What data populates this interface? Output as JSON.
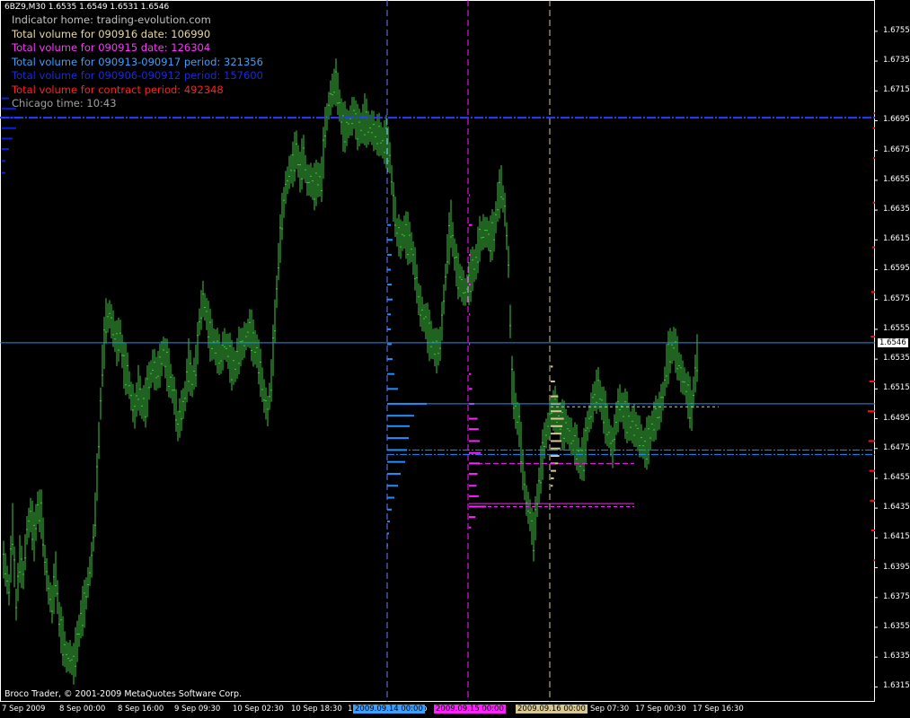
{
  "window": {
    "title": "6BZ9,M30  1.6535 1.6549 1.6531 1.6546",
    "copyright": "Broco Trader, © 2001-2009 MetaQuotes Software Corp."
  },
  "info_lines": [
    {
      "label": "Indicator home: trading-evolution.com",
      "value": "",
      "color": "#c0c0c0"
    },
    {
      "label": "Total volume for 090916 date: ",
      "value": "106990",
      "color": "#e8d8a8"
    },
    {
      "label": "Total volume for 090915 date: ",
      "value": "126304",
      "color": "#ff33ff"
    },
    {
      "label": "Total volume for 090913-090917 period: ",
      "value": "321356",
      "color": "#3aa0ff"
    },
    {
      "label": "Total volume for 090906-090912 period: ",
      "value": "157600",
      "color": "#1a2ad8"
    },
    {
      "label": "Total volume for contract period: ",
      "value": "492348",
      "color": "#ff2020"
    },
    {
      "label": "Chicago time: ",
      "value": "10:43",
      "color": "#a0a0a0"
    }
  ],
  "current_price_label": "1.6546",
  "colors": {
    "candles": "#3fc43f",
    "profile_week": "#1e90ff",
    "profile_prev_week": "#0a1ee0",
    "profile_0915": "#ff20ff",
    "profile_0916": "#d8c890",
    "profile_contract": "#ff1010",
    "session_0914": "#6b7cff",
    "session_0915": "#ff20ff",
    "session_0916": "#d8c890"
  },
  "chart_data": {
    "type": "candlestick",
    "symbol": "6BZ9",
    "timeframe": "M30",
    "y_ticks": [
      "1.6755",
      "1.6735",
      "1.6715",
      "1.6695",
      "1.6675",
      "1.6655",
      "1.6635",
      "1.6615",
      "1.6595",
      "1.6575",
      "1.6555",
      "1.6535",
      "1.6515",
      "1.6495",
      "1.6475",
      "1.6455",
      "1.6435",
      "1.6415",
      "1.6395",
      "1.6375",
      "1.6355",
      "1.6335",
      "1.6315"
    ],
    "ylim": [
      1.6311,
      1.6776
    ],
    "x_ticks": [
      "7 Sep 2009",
      "8 Sep 00:00",
      "8 Sep 16:00",
      "9 Sep 09:30",
      "10 Sep 02:30",
      "10 Sep 18:30",
      "1",
      "p",
      "Sep 07:30",
      "17 Sep 00:30",
      "17 Sep 16:30"
    ],
    "session_markers": [
      {
        "label": "2009.09.14 00:00",
        "color": "#3aa0ff"
      },
      {
        "label": "2009.09.15 00:00",
        "color": "#ff20ff"
      },
      {
        "label": "2009.09.16 00:00",
        "color": "#d8c890"
      }
    ],
    "current_price": 1.6546,
    "levels": [
      {
        "name": "prev-week-poc",
        "price": 1.6697
      },
      {
        "name": "week-poc",
        "price": 1.6505
      },
      {
        "name": "value-area-high",
        "price": 1.6474
      },
      {
        "name": "value-area-low",
        "price": 1.6471
      },
      {
        "name": "0915-poc-high",
        "price": 1.6438
      },
      {
        "name": "0915-poc-low",
        "price": 1.6436
      },
      {
        "name": "0915-va",
        "price": 1.6465
      }
    ],
    "price_path": [
      [
        0,
        1.64
      ],
      [
        6,
        1.638
      ],
      [
        10,
        1.642
      ],
      [
        14,
        1.637
      ],
      [
        18,
        1.64
      ],
      [
        22,
        1.639
      ],
      [
        26,
        1.642
      ],
      [
        30,
        1.643
      ],
      [
        34,
        1.6415
      ],
      [
        38,
        1.6435
      ],
      [
        42,
        1.643
      ],
      [
        46,
        1.64
      ],
      [
        50,
        1.638
      ],
      [
        54,
        1.637
      ],
      [
        58,
        1.639
      ],
      [
        62,
        1.636
      ],
      [
        66,
        1.6345
      ],
      [
        70,
        1.6335
      ],
      [
        74,
        1.6335
      ],
      [
        78,
        1.633
      ],
      [
        82,
        1.6345
      ],
      [
        86,
        1.636
      ],
      [
        90,
        1.637
      ],
      [
        94,
        1.6385
      ],
      [
        98,
        1.64
      ],
      [
        102,
        1.643
      ],
      [
        106,
        1.648
      ],
      [
        110,
        1.653
      ],
      [
        114,
        1.656
      ],
      [
        118,
        1.6565
      ],
      [
        122,
        1.6555
      ],
      [
        126,
        1.6545
      ],
      [
        130,
        1.655
      ],
      [
        134,
        1.653
      ],
      [
        138,
        1.6525
      ],
      [
        142,
        1.651
      ],
      [
        146,
        1.65
      ],
      [
        150,
        1.6515
      ],
      [
        154,
        1.6505
      ],
      [
        158,
        1.6505
      ],
      [
        162,
        1.652
      ],
      [
        166,
        1.653
      ],
      [
        170,
        1.6525
      ],
      [
        174,
        1.653
      ],
      [
        178,
        1.654
      ],
      [
        182,
        1.653
      ],
      [
        186,
        1.652
      ],
      [
        190,
        1.651
      ],
      [
        194,
        1.649
      ],
      [
        198,
        1.65
      ],
      [
        202,
        1.651
      ],
      [
        206,
        1.653
      ],
      [
        210,
        1.652
      ],
      [
        214,
        1.653
      ],
      [
        218,
        1.656
      ],
      [
        222,
        1.6575
      ],
      [
        226,
        1.6565
      ],
      [
        230,
        1.655
      ],
      [
        234,
        1.6545
      ],
      [
        238,
        1.654
      ],
      [
        242,
        1.6535
      ],
      [
        246,
        1.6545
      ],
      [
        250,
        1.654
      ],
      [
        254,
        1.653
      ],
      [
        258,
        1.653
      ],
      [
        262,
        1.654
      ],
      [
        266,
        1.6545
      ],
      [
        270,
        1.655
      ],
      [
        274,
        1.6555
      ],
      [
        278,
        1.6545
      ],
      [
        282,
        1.654
      ],
      [
        286,
        1.6525
      ],
      [
        290,
        1.651
      ],
      [
        294,
        1.65
      ],
      [
        298,
        1.652
      ],
      [
        302,
        1.656
      ],
      [
        306,
        1.66
      ],
      [
        310,
        1.663
      ],
      [
        314,
        1.665
      ],
      [
        318,
        1.666
      ],
      [
        322,
        1.6665
      ],
      [
        326,
        1.6675
      ],
      [
        330,
        1.666
      ],
      [
        334,
        1.667
      ],
      [
        338,
        1.6655
      ],
      [
        342,
        1.6655
      ],
      [
        346,
        1.665
      ],
      [
        350,
        1.6655
      ],
      [
        354,
        1.6655
      ],
      [
        358,
        1.669
      ],
      [
        362,
        1.6705
      ],
      [
        366,
        1.6715
      ],
      [
        370,
        1.672
      ],
      [
        374,
        1.6705
      ],
      [
        378,
        1.669
      ],
      [
        382,
        1.669
      ],
      [
        386,
        1.6695
      ],
      [
        390,
        1.67
      ],
      [
        394,
        1.669
      ],
      [
        398,
        1.669
      ],
      [
        402,
        1.6695
      ],
      [
        406,
        1.669
      ],
      [
        410,
        1.669
      ],
      [
        414,
        1.6685
      ],
      [
        418,
        1.6685
      ],
      [
        422,
        1.668
      ],
      [
        426,
        1.668
      ],
      [
        430,
        1.667
      ],
      [
        434,
        1.664
      ],
      [
        438,
        1.662
      ],
      [
        442,
        1.6615
      ],
      [
        446,
        1.662
      ],
      [
        450,
        1.6615
      ],
      [
        454,
        1.661
      ],
      [
        458,
        1.6595
      ],
      [
        462,
        1.6575
      ],
      [
        466,
        1.6565
      ],
      [
        470,
        1.656
      ],
      [
        474,
        1.655
      ],
      [
        478,
        1.6545
      ],
      [
        482,
        1.654
      ],
      [
        486,
        1.6545
      ],
      [
        490,
        1.6575
      ],
      [
        494,
        1.6605
      ],
      [
        498,
        1.6625
      ],
      [
        502,
        1.6605
      ],
      [
        506,
        1.659
      ],
      [
        510,
        1.6585
      ],
      [
        514,
        1.658
      ],
      [
        518,
        1.6585
      ],
      [
        522,
        1.6595
      ],
      [
        526,
        1.66
      ],
      [
        530,
        1.6615
      ],
      [
        534,
        1.662
      ],
      [
        538,
        1.662
      ],
      [
        542,
        1.6615
      ],
      [
        546,
        1.662
      ],
      [
        550,
        1.664
      ],
      [
        554,
        1.665
      ],
      [
        558,
        1.6635
      ],
      [
        562,
        1.66
      ],
      [
        566,
        1.652
      ],
      [
        570,
        1.65
      ],
      [
        574,
        1.649
      ],
      [
        578,
        1.646
      ],
      [
        582,
        1.644
      ],
      [
        586,
        1.643
      ],
      [
        590,
        1.6415
      ],
      [
        594,
        1.644
      ],
      [
        598,
        1.646
      ],
      [
        602,
        1.648
      ],
      [
        606,
        1.649
      ],
      [
        610,
        1.65
      ],
      [
        614,
        1.65
      ],
      [
        618,
        1.6495
      ],
      [
        622,
        1.649
      ],
      [
        626,
        1.649
      ],
      [
        630,
        1.6485
      ],
      [
        634,
        1.648
      ],
      [
        638,
        1.6475
      ],
      [
        642,
        1.6465
      ],
      [
        646,
        1.647
      ],
      [
        650,
        1.649
      ],
      [
        654,
        1.65
      ],
      [
        658,
        1.651
      ],
      [
        662,
        1.6515
      ],
      [
        666,
        1.6505
      ],
      [
        670,
        1.6495
      ],
      [
        674,
        1.6485
      ],
      [
        678,
        1.6475
      ],
      [
        682,
        1.6495
      ],
      [
        686,
        1.6505
      ],
      [
        690,
        1.65
      ],
      [
        694,
        1.6495
      ],
      [
        698,
        1.649
      ],
      [
        702,
        1.649
      ],
      [
        706,
        1.6485
      ],
      [
        710,
        1.648
      ],
      [
        714,
        1.6475
      ],
      [
        718,
        1.648
      ],
      [
        722,
        1.649
      ],
      [
        726,
        1.6495
      ],
      [
        730,
        1.65
      ],
      [
        734,
        1.651
      ],
      [
        738,
        1.653
      ],
      [
        742,
        1.654
      ],
      [
        746,
        1.6545
      ],
      [
        750,
        1.6535
      ],
      [
        754,
        1.6525
      ],
      [
        758,
        1.652
      ],
      [
        762,
        1.651
      ],
      [
        766,
        1.65
      ],
      [
        770,
        1.6525
      ],
      [
        774,
        1.6545
      ]
    ],
    "profile_week": [
      [
        1.6625,
        0.04
      ],
      [
        1.6615,
        0.06
      ],
      [
        1.6605,
        0.05
      ],
      [
        1.6595,
        0.04
      ],
      [
        1.6585,
        0.05
      ],
      [
        1.6575,
        0.06
      ],
      [
        1.6565,
        0.04
      ],
      [
        1.6555,
        0.04
      ],
      [
        1.6545,
        0.05
      ],
      [
        1.6535,
        0.06
      ],
      [
        1.6525,
        0.08
      ],
      [
        1.6515,
        0.12
      ],
      [
        1.6505,
        0.44
      ],
      [
        1.6497,
        0.3
      ],
      [
        1.649,
        0.25
      ],
      [
        1.6482,
        0.24
      ],
      [
        1.6474,
        0.22
      ],
      [
        1.6466,
        0.2
      ],
      [
        1.6458,
        0.15
      ],
      [
        1.645,
        0.12
      ],
      [
        1.6442,
        0.08
      ],
      [
        1.6434,
        0.05
      ],
      [
        1.6426,
        0.03
      ],
      [
        1.6418,
        0.02
      ],
      [
        1.641,
        0.01
      ]
    ],
    "profile_0915": [
      [
        1.6645,
        0.01
      ],
      [
        1.6625,
        0.03
      ],
      [
        1.6605,
        0.02
      ],
      [
        1.6585,
        0.02
      ],
      [
        1.6565,
        0.01
      ],
      [
        1.6545,
        0.01
      ],
      [
        1.6525,
        0.02
      ],
      [
        1.6515,
        0.03
      ],
      [
        1.6505,
        0.05
      ],
      [
        1.6495,
        0.08
      ],
      [
        1.6488,
        0.09
      ],
      [
        1.648,
        0.1
      ],
      [
        1.6472,
        0.11
      ],
      [
        1.6465,
        0.1
      ],
      [
        1.6458,
        0.08
      ],
      [
        1.645,
        0.07
      ],
      [
        1.6443,
        0.09
      ],
      [
        1.6436,
        0.16
      ],
      [
        1.6429,
        0.06
      ],
      [
        1.6422,
        0.02
      ]
    ],
    "profile_0916": [
      [
        1.653,
        0.02
      ],
      [
        1.652,
        0.04
      ],
      [
        1.651,
        0.07
      ],
      [
        1.6505,
        0.09
      ],
      [
        1.65,
        0.1
      ],
      [
        1.6495,
        0.12
      ],
      [
        1.649,
        0.11
      ],
      [
        1.6485,
        0.1
      ],
      [
        1.648,
        0.1
      ],
      [
        1.6475,
        0.09
      ],
      [
        1.647,
        0.08
      ],
      [
        1.6465,
        0.07
      ],
      [
        1.646,
        0.05
      ],
      [
        1.6455,
        0.03
      ],
      [
        1.645,
        0.02
      ]
    ],
    "profile_prev_week": [
      [
        1.671,
        0.02
      ],
      [
        1.6703,
        0.04
      ],
      [
        1.6697,
        0.05
      ],
      [
        1.669,
        0.04
      ],
      [
        1.6683,
        0.03
      ],
      [
        1.6676,
        0.02
      ],
      [
        1.6668,
        0.01
      ],
      [
        1.666,
        0.01
      ]
    ],
    "profile_contract": [
      [
        1.67,
        0.2
      ],
      [
        1.669,
        0.3
      ],
      [
        1.667,
        0.25
      ],
      [
        1.664,
        0.3
      ],
      [
        1.661,
        0.4
      ],
      [
        1.658,
        0.5
      ],
      [
        1.655,
        0.6
      ],
      [
        1.652,
        0.8
      ],
      [
        1.65,
        1.0
      ],
      [
        1.648,
        0.9
      ],
      [
        1.646,
        0.8
      ],
      [
        1.644,
        0.7
      ],
      [
        1.642,
        0.5
      ],
      [
        1.64,
        0.2
      ]
    ]
  }
}
